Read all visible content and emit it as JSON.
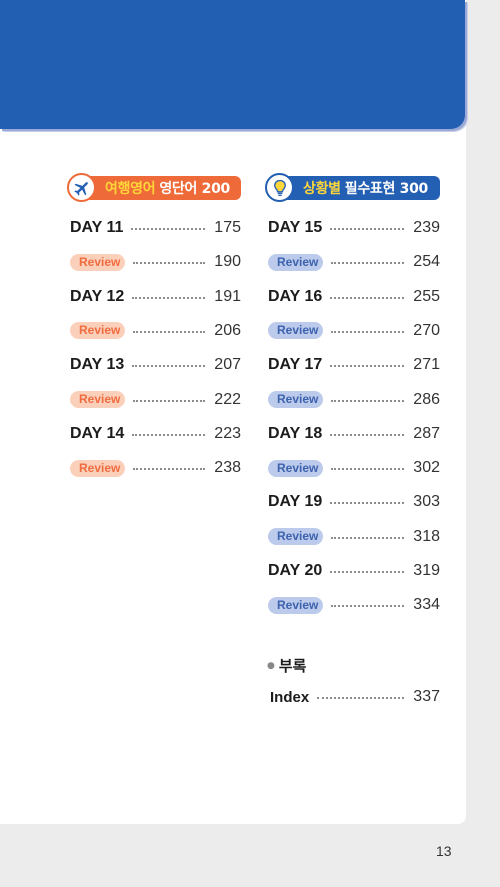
{
  "colors": {
    "banner": "#225eb1",
    "orange": "#ee6a38",
    "blue": "#235fb2",
    "highlight": "#ffd63a"
  },
  "left_section": {
    "icon": "airplane-icon",
    "title_highlight": "여행영어",
    "title_rest": "영단어 200",
    "entries": [
      {
        "kind": "day",
        "label": "DAY 11",
        "page": "175"
      },
      {
        "kind": "review",
        "label": "Review",
        "page": "190"
      },
      {
        "kind": "day",
        "label": "DAY 12",
        "page": "191"
      },
      {
        "kind": "review",
        "label": "Review",
        "page": "206"
      },
      {
        "kind": "day",
        "label": "DAY 13",
        "page": "207"
      },
      {
        "kind": "review",
        "label": "Review",
        "page": "222"
      },
      {
        "kind": "day",
        "label": "DAY 14",
        "page": "223"
      },
      {
        "kind": "review",
        "label": "Review",
        "page": "238"
      }
    ]
  },
  "right_section": {
    "icon": "lightbulb-icon",
    "title_highlight": "상황별",
    "title_rest": "필수표현 300",
    "entries": [
      {
        "kind": "day",
        "label": "DAY 15",
        "page": "239"
      },
      {
        "kind": "review",
        "label": "Review",
        "page": "254"
      },
      {
        "kind": "day",
        "label": "DAY 16",
        "page": "255"
      },
      {
        "kind": "review",
        "label": "Review",
        "page": "270"
      },
      {
        "kind": "day",
        "label": "DAY 17",
        "page": "271"
      },
      {
        "kind": "review",
        "label": "Review",
        "page": "286"
      },
      {
        "kind": "day",
        "label": "DAY 18",
        "page": "287"
      },
      {
        "kind": "review",
        "label": "Review",
        "page": "302"
      },
      {
        "kind": "day",
        "label": "DAY 19",
        "page": "303"
      },
      {
        "kind": "review",
        "label": "Review",
        "page": "318"
      },
      {
        "kind": "day",
        "label": "DAY 20",
        "page": "319"
      },
      {
        "kind": "review",
        "label": "Review",
        "page": "334"
      }
    ]
  },
  "appendix": {
    "title": "부록",
    "index_label": "Index",
    "index_page": "337"
  },
  "page_number": "13"
}
